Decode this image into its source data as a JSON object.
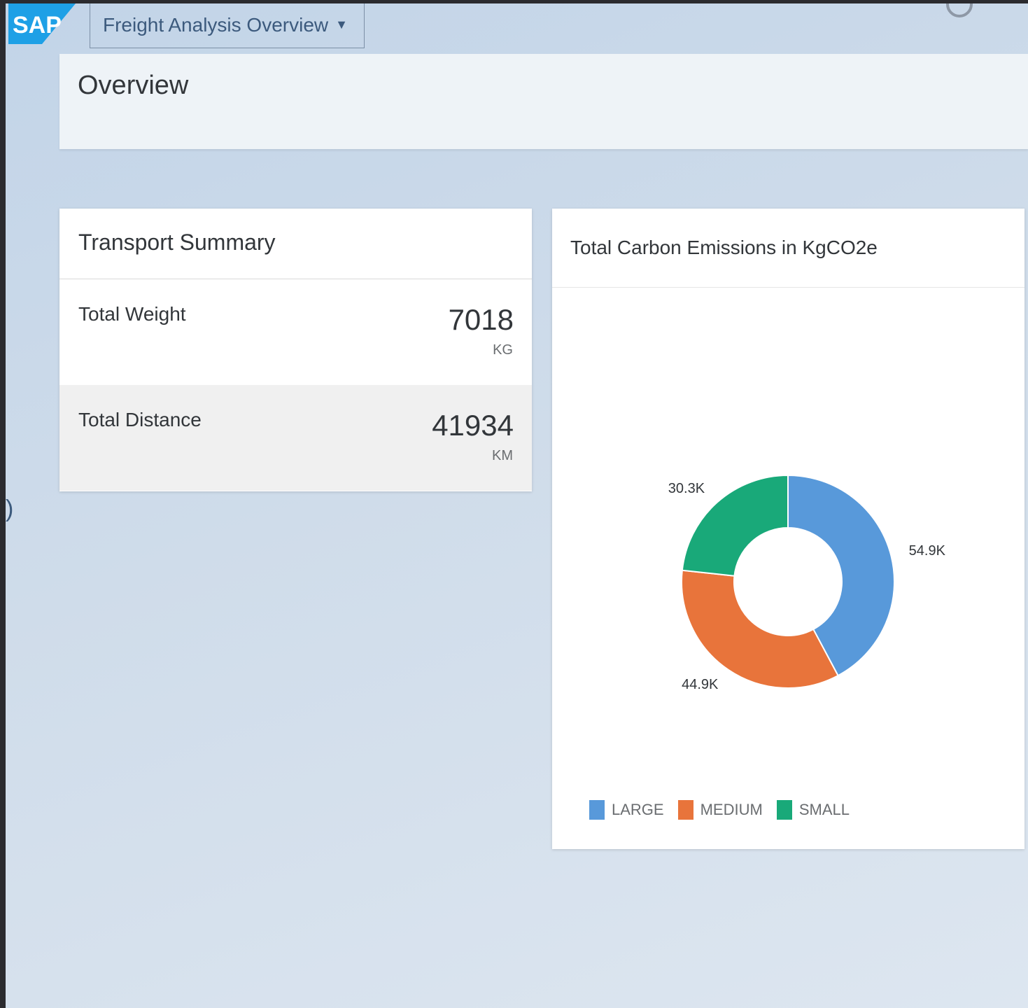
{
  "shell": {
    "logo_text": "SAP",
    "app_title": "Freight Analysis Overview",
    "caret_icon": "caret-down-icon"
  },
  "page": {
    "title": "Overview"
  },
  "transport_summary": {
    "title": "Transport Summary",
    "kpis": [
      {
        "label": "Total Weight",
        "value": "7018",
        "unit": "KG"
      },
      {
        "label": "Total Distance",
        "value": "41934",
        "unit": "KM"
      }
    ]
  },
  "emissions_card": {
    "title": "Total Carbon Emissions in KgCO2e"
  },
  "colors": {
    "large": "#5899da",
    "medium": "#e8743b",
    "small": "#19a979",
    "brand": "#0a6ed1"
  },
  "chart_data": {
    "type": "pie",
    "donut": true,
    "title": "Total Carbon Emissions in KgCO2e",
    "categories": [
      "LARGE",
      "MEDIUM",
      "SMALL"
    ],
    "values": [
      54900,
      44900,
      30300
    ],
    "data_labels": [
      "54.9K",
      "44.9K",
      "30.3K"
    ],
    "legend_position": "bottom-left"
  }
}
